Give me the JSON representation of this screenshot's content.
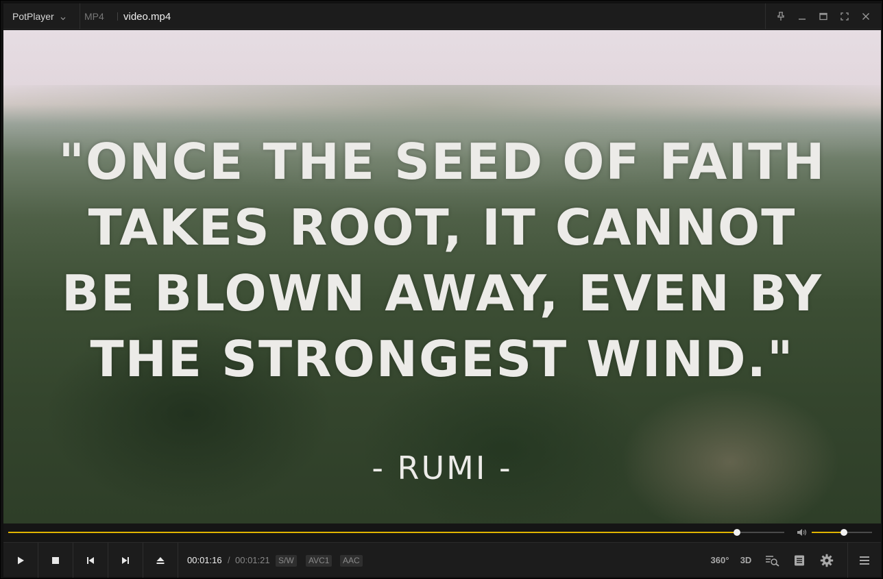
{
  "titlebar": {
    "app_name": "PotPlayer",
    "format": "MP4",
    "file_name": "video.mp4"
  },
  "video": {
    "quote_lines": [
      "\"ONCE THE SEED OF FAITH",
      "TAKES ROOT, IT CANNOT",
      "BE BLOWN AWAY, EVEN BY",
      "THE STRONGEST WIND.\""
    ],
    "author": "- RUMI -"
  },
  "playback": {
    "current_time": "00:01:16",
    "separator": "/",
    "total_time": "00:01:21",
    "progress_fraction": 0.939,
    "volume_fraction": 0.53
  },
  "badges": {
    "decoder": "S/W",
    "video_codec": "AVC1",
    "audio_codec": "AAC"
  },
  "icons": {
    "btn_360": "360°",
    "btn_3d": "3D"
  },
  "colors": {
    "accent": "#e0b400",
    "background": "#1c1c1c"
  }
}
